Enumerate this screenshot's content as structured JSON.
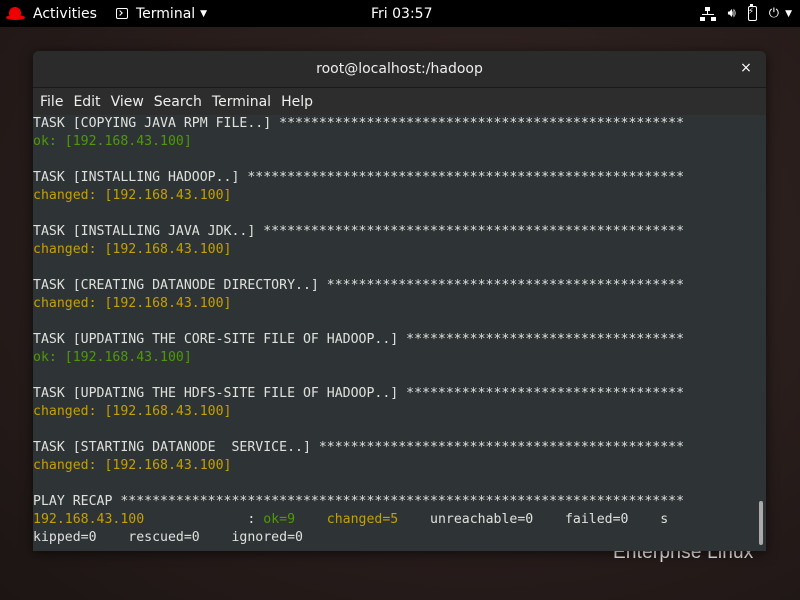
{
  "topbar": {
    "activities": "Activities",
    "app_menu": "Terminal",
    "clock": "Fri 03:57"
  },
  "wallpaper": {
    "brand_text": "Enterprise Linux"
  },
  "window": {
    "title": "root@localhost:/hadoop",
    "close_label": "×",
    "menu": [
      "File",
      "Edit",
      "View",
      "Search",
      "Terminal",
      "Help"
    ]
  },
  "terminal": {
    "lines": [
      {
        "segments": [
          {
            "text": "TASK [COPYING JAVA RPM FILE..] ***************************************************",
            "cls": ""
          }
        ]
      },
      {
        "segments": [
          {
            "text": "ok: [192.168.43.100]",
            "cls": "ok"
          }
        ]
      },
      {
        "segments": [
          {
            "text": "",
            "cls": ""
          }
        ]
      },
      {
        "segments": [
          {
            "text": "TASK [INSTALLING HADOOP..] *******************************************************",
            "cls": ""
          }
        ]
      },
      {
        "segments": [
          {
            "text": "changed: [192.168.43.100]",
            "cls": "changed"
          }
        ]
      },
      {
        "segments": [
          {
            "text": "",
            "cls": ""
          }
        ]
      },
      {
        "segments": [
          {
            "text": "TASK [INSTALLING JAVA JDK..] *****************************************************",
            "cls": ""
          }
        ]
      },
      {
        "segments": [
          {
            "text": "changed: [192.168.43.100]",
            "cls": "changed"
          }
        ]
      },
      {
        "segments": [
          {
            "text": "",
            "cls": ""
          }
        ]
      },
      {
        "segments": [
          {
            "text": "TASK [CREATING DATANODE DIRECTORY..] *********************************************",
            "cls": ""
          }
        ]
      },
      {
        "segments": [
          {
            "text": "changed: [192.168.43.100]",
            "cls": "changed"
          }
        ]
      },
      {
        "segments": [
          {
            "text": "",
            "cls": ""
          }
        ]
      },
      {
        "segments": [
          {
            "text": "TASK [UPDATING THE CORE-SITE FILE OF HADOOP..] ***********************************",
            "cls": ""
          }
        ]
      },
      {
        "segments": [
          {
            "text": "ok: [192.168.43.100]",
            "cls": "ok"
          }
        ]
      },
      {
        "segments": [
          {
            "text": "",
            "cls": ""
          }
        ]
      },
      {
        "segments": [
          {
            "text": "TASK [UPDATING THE HDFS-SITE FILE OF HADOOP..] ***********************************",
            "cls": ""
          }
        ]
      },
      {
        "segments": [
          {
            "text": "changed: [192.168.43.100]",
            "cls": "changed"
          }
        ]
      },
      {
        "segments": [
          {
            "text": "",
            "cls": ""
          }
        ]
      },
      {
        "segments": [
          {
            "text": "TASK [STARTING DATANODE  SERVICE..] **********************************************",
            "cls": ""
          }
        ]
      },
      {
        "segments": [
          {
            "text": "changed: [192.168.43.100]",
            "cls": "changed"
          }
        ]
      },
      {
        "segments": [
          {
            "text": "",
            "cls": ""
          }
        ]
      },
      {
        "segments": [
          {
            "text": "PLAY RECAP ***********************************************************************",
            "cls": ""
          }
        ]
      },
      {
        "segments": [
          {
            "text": "192.168.43.100",
            "cls": "changed"
          },
          {
            "text": "             : ",
            "cls": ""
          },
          {
            "text": "ok=9",
            "cls": "ok"
          },
          {
            "text": "    ",
            "cls": ""
          },
          {
            "text": "changed=5",
            "cls": "changed"
          },
          {
            "text": "    unreachable=0    failed=0    s",
            "cls": ""
          }
        ]
      },
      {
        "segments": [
          {
            "text": "kipped=0    rescued=0    ignored=0",
            "cls": ""
          }
        ]
      }
    ]
  }
}
